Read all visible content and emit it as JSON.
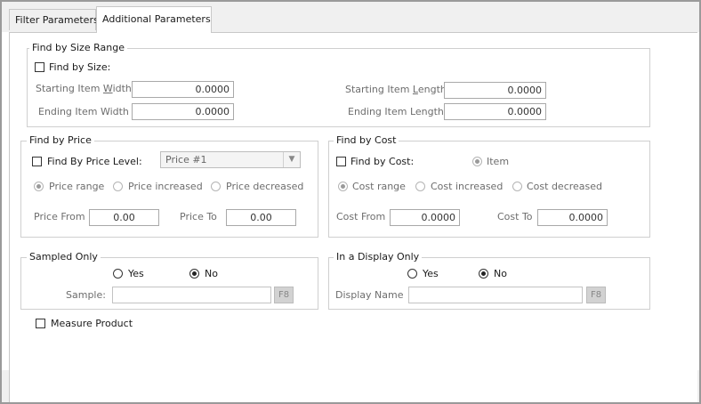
{
  "tabs": [
    {
      "label": "Filter Parameters"
    },
    {
      "label": "Additional Parameters"
    }
  ],
  "size_range": {
    "title": "Find by Size Range",
    "checkbox_label": "Find by Size:",
    "starting_width_label_pre": "Starting Item ",
    "starting_width_label_hot": "W",
    "starting_width_label_post": "idth",
    "starting_width_value": "0.0000",
    "ending_width_label": "Ending Item Width",
    "ending_width_value": "0.0000",
    "starting_length_label_pre": "Starting Item ",
    "starting_length_label_hot": "L",
    "starting_length_label_post": "ength",
    "starting_length_value": "0.0000",
    "ending_length_label": "Ending Item Length",
    "ending_length_value": "0.0000"
  },
  "price": {
    "title": "Find by Price",
    "checkbox_label": "Find By Price Level:",
    "price_level_value": "Price #1",
    "radio_range": "Price range",
    "radio_increased": "Price increased",
    "radio_decreased": "Price decreased",
    "from_label": "Price From",
    "from_value": "0.00",
    "to_label": "Price To",
    "to_value": "0.00"
  },
  "cost": {
    "title": "Find by Cost",
    "checkbox_label": "Find by Cost:",
    "radio_item": "Item",
    "radio_range": "Cost range",
    "radio_increased": "Cost increased",
    "radio_decreased": "Cost decreased",
    "from_label": "Cost From",
    "from_value": "0.0000",
    "to_label": "Cost To",
    "to_value": "0.0000"
  },
  "sampled": {
    "title": "Sampled Only",
    "yes_label": "Yes",
    "no_label": "No",
    "selected": "No",
    "sample_label": "Sample:",
    "sample_value": "",
    "f8_label": "F8"
  },
  "display": {
    "title": "In a Display Only",
    "yes_label": "Yes",
    "no_label": "No",
    "selected": "No",
    "name_label": "Display Name",
    "name_value": "",
    "f8_label": "F8"
  },
  "measure_product": {
    "label": "Measure Product",
    "checked": false
  }
}
